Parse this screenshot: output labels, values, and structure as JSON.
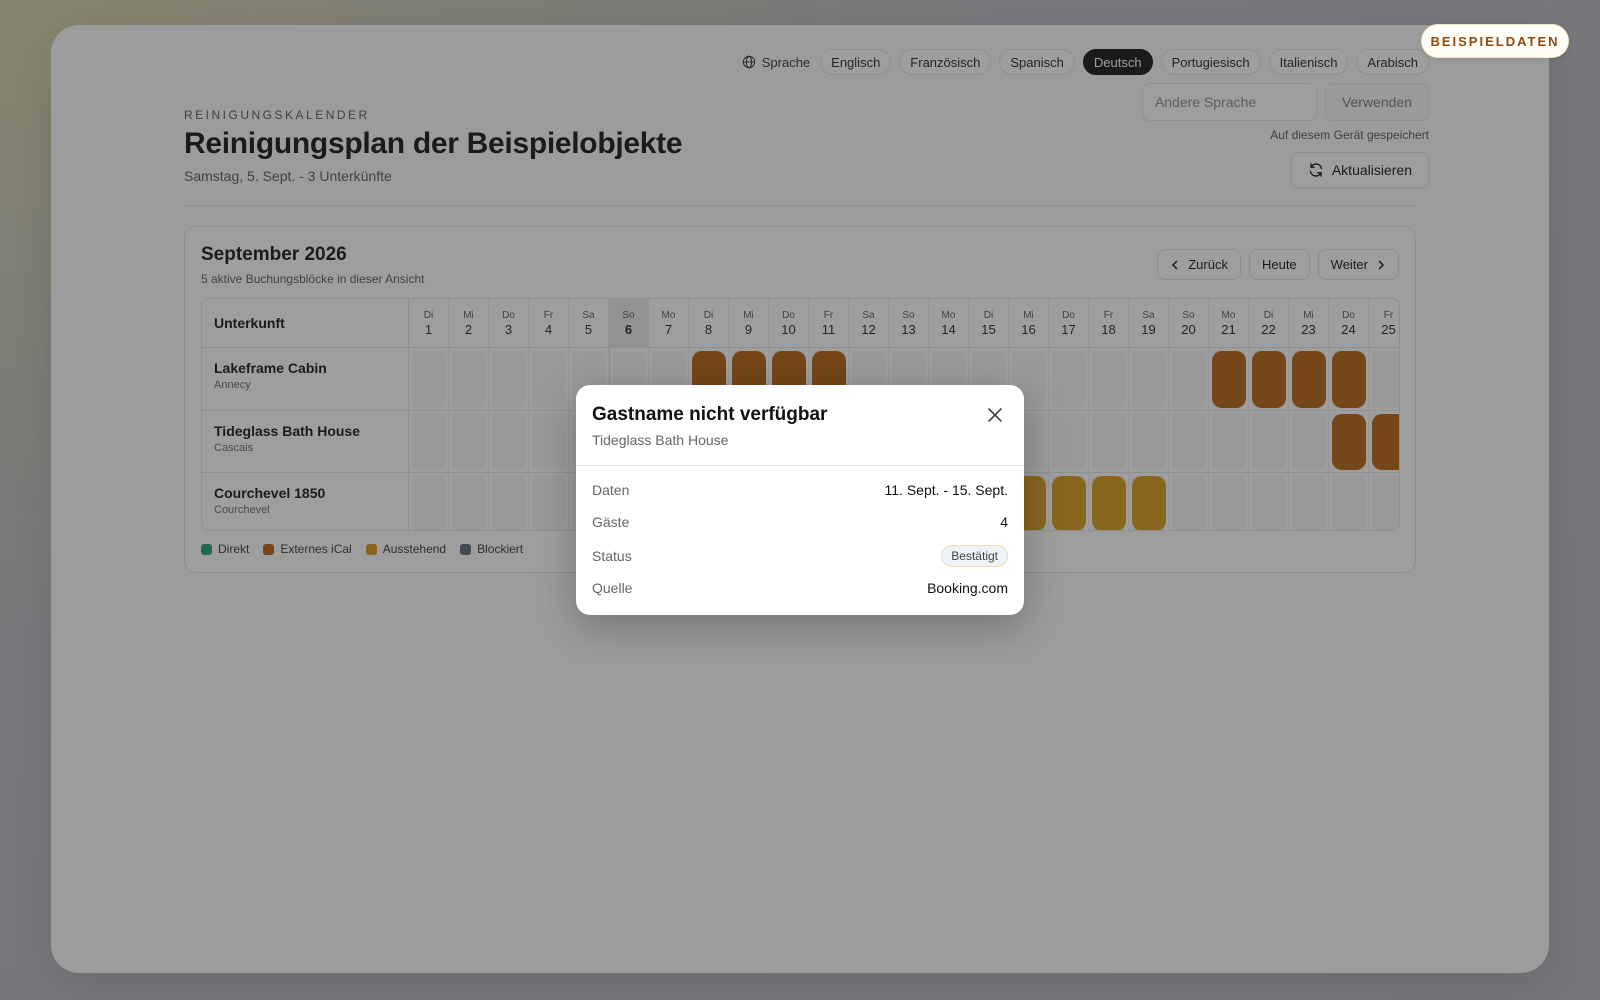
{
  "badge": "BEISPIELDATEN",
  "language": {
    "label": "Sprache",
    "options": [
      "Englisch",
      "Französisch",
      "Spanisch",
      "Deutsch",
      "Portugiesisch",
      "Italienisch",
      "Arabisch"
    ],
    "active": "Deutsch",
    "other_placeholder": "Andere Sprache",
    "use_label": "Verwenden",
    "saved_note": "Auf diesem Gerät gespeichert"
  },
  "refresh_label": "Aktualisieren",
  "header": {
    "eyebrow": "REINIGUNGSKALENDER",
    "title": "Reinigungsplan der Beispielobjekte",
    "subtitle": "Samstag, 5. Sept. - 3 Unterkünfte"
  },
  "calendar": {
    "title": "September 2026",
    "subtitle": "5 aktive Buchungsblöcke in dieser Ansicht",
    "nav": {
      "prev": "Zurück",
      "today": "Heute",
      "next": "Weiter"
    },
    "property_header": "Unterkunft",
    "today_day": 6,
    "days": [
      {
        "w": "Di",
        "d": "1"
      },
      {
        "w": "Mi",
        "d": "2"
      },
      {
        "w": "Do",
        "d": "3"
      },
      {
        "w": "Fr",
        "d": "4"
      },
      {
        "w": "Sa",
        "d": "5"
      },
      {
        "w": "So",
        "d": "6"
      },
      {
        "w": "Mo",
        "d": "7"
      },
      {
        "w": "Di",
        "d": "8"
      },
      {
        "w": "Mi",
        "d": "9"
      },
      {
        "w": "Do",
        "d": "10"
      },
      {
        "w": "Fr",
        "d": "11"
      },
      {
        "w": "Sa",
        "d": "12"
      },
      {
        "w": "So",
        "d": "13"
      },
      {
        "w": "Mo",
        "d": "14"
      },
      {
        "w": "Di",
        "d": "15"
      },
      {
        "w": "Mi",
        "d": "16"
      },
      {
        "w": "Do",
        "d": "17"
      },
      {
        "w": "Fr",
        "d": "18"
      },
      {
        "w": "Sa",
        "d": "19"
      },
      {
        "w": "So",
        "d": "20"
      },
      {
        "w": "Mo",
        "d": "21"
      },
      {
        "w": "Di",
        "d": "22"
      },
      {
        "w": "Mi",
        "d": "23"
      },
      {
        "w": "Do",
        "d": "24"
      },
      {
        "w": "Fr",
        "d": "25"
      }
    ],
    "properties": [
      {
        "name": "Lakeframe Cabin",
        "city": "Annecy"
      },
      {
        "name": "Tideglass Bath House",
        "city": "Cascais"
      },
      {
        "name": "Courchevel 1850",
        "city": "Courchevel"
      }
    ],
    "bookings": [
      {
        "property": 0,
        "days": [
          8,
          9,
          10,
          11
        ],
        "type": "ical"
      },
      {
        "property": 0,
        "days": [
          21,
          22,
          23,
          24
        ],
        "type": "ical"
      },
      {
        "property": 1,
        "days": [
          11,
          12,
          13,
          14,
          15
        ],
        "type": "ical"
      },
      {
        "property": 1,
        "days": [
          24,
          25
        ],
        "type": "ical"
      },
      {
        "property": 2,
        "days": [
          16,
          17,
          18,
          19
        ],
        "type": "pending"
      }
    ],
    "legend": [
      {
        "label": "Direkt",
        "color": "#1f9d6b"
      },
      {
        "label": "Externes iCal",
        "color": "#b35f0c"
      },
      {
        "label": "Ausstehend",
        "color": "#d99a14"
      },
      {
        "label": "Blockiert",
        "color": "#5b6478"
      }
    ],
    "colors": {
      "ical": "#b35f0c",
      "pending": "#d99a14"
    }
  },
  "modal": {
    "title": "Gastname nicht verfügbar",
    "subtitle": "Tideglass Bath House",
    "rows": {
      "dates_label": "Daten",
      "dates_value": "11. Sept. - 15. Sept.",
      "guests_label": "Gäste",
      "guests_value": "4",
      "status_label": "Status",
      "status_value": "Bestätigt",
      "source_label": "Quelle",
      "source_value": "Booking.com"
    }
  }
}
